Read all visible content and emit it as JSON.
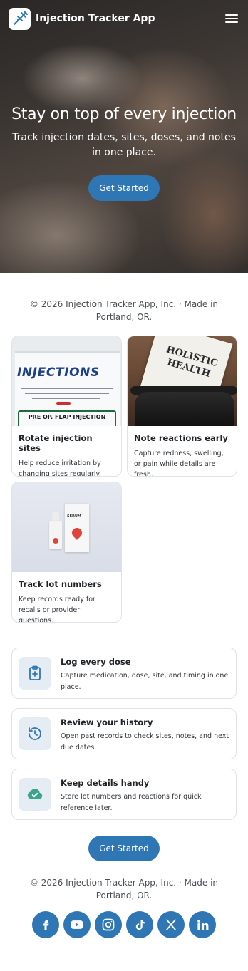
{
  "header": {
    "app_name": "Injection Tracker App",
    "logo_icon": "syringe-icon",
    "menu_icon": "hamburger-menu-icon"
  },
  "hero": {
    "title": "Stay on top of every injection",
    "subtitle": "Track injection dates, sites, doses, and notes in one place.",
    "cta_label": "Get Started"
  },
  "footer_note": "© 2026 Injection Tracker App, Inc. · Made in Portland, OR.",
  "cards": [
    {
      "title": "Rotate injection sites",
      "text": "Help reduce irritation by changing sites regularly.",
      "image_text": [
        "INJECTIONS",
        "PRE OP. FLAP INJECTION"
      ]
    },
    {
      "title": "Note reactions early",
      "text": "Capture redness, swelling, or pain while details are fresh.",
      "image_text": [
        "HOLISTIC",
        "HEALTH"
      ]
    },
    {
      "title": "Track lot numbers",
      "text": "Keep records ready for recalls or provider questions.",
      "image_text": [
        "SERUM"
      ]
    }
  ],
  "features": [
    {
      "title": "Log every dose",
      "text": "Capture medication, dose, site, and timing in one place.",
      "icon": "clipboard-plus-icon"
    },
    {
      "title": "Review your history",
      "text": "Open past records to check sites, notes, and next due dates.",
      "icon": "history-icon"
    },
    {
      "title": "Keep details handy",
      "text": "Store lot numbers and reactions for quick reference later.",
      "icon": "cloud-check-icon"
    }
  ],
  "bottom_cta_label": "Get Started",
  "socials": [
    "facebook-icon",
    "youtube-icon",
    "instagram-icon",
    "tiktok-icon",
    "x-icon",
    "linkedin-icon"
  ],
  "colors": {
    "primary": "#2f76b5",
    "feature_icon_bg": "#e6ecf3",
    "accent_green": "#3aa58c"
  }
}
